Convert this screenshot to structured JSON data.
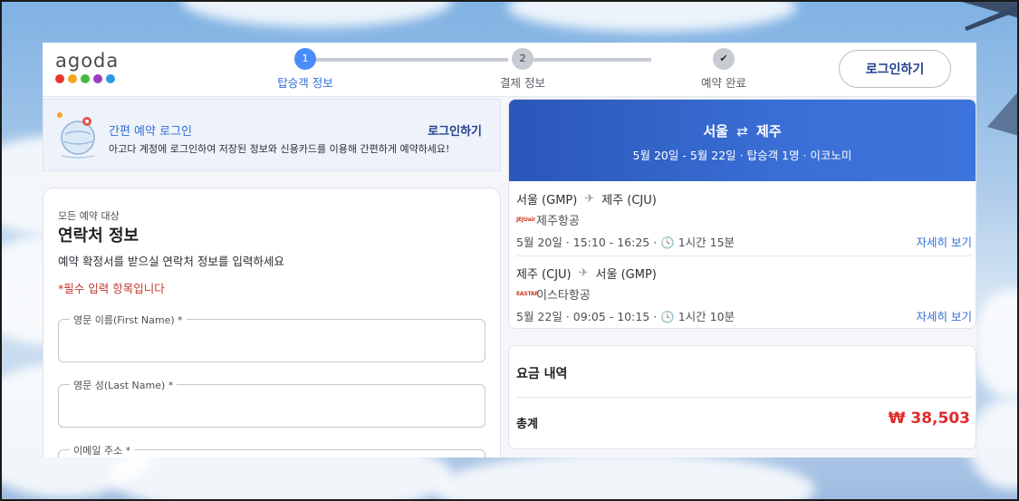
{
  "logo": {
    "text": "agoda",
    "dot_colors": [
      "#e8362f",
      "#f5a623",
      "#46b83f",
      "#9b3cc4",
      "#2c9ae0"
    ]
  },
  "stepper": {
    "steps": [
      {
        "number": "1",
        "label": "탑승객 정보",
        "state": "active"
      },
      {
        "number": "2",
        "label": "결제 정보",
        "state": "pending"
      },
      {
        "number": "✔",
        "label": "예약 완료",
        "state": "done"
      }
    ]
  },
  "header": {
    "login_label": "로그인하기"
  },
  "banner": {
    "title": "간편 예약 로그인",
    "description": "아고다 계정에 로그인하여 저장된 정보와 신용카드를 이용해 간편하게 예약하세요!",
    "link": "로그인하기"
  },
  "contact": {
    "kicker": "모든 예약 대상",
    "title": "연락처 정보",
    "description": "예약 확정서를 받으실 연락처 정보를 입력하세요",
    "required_note": "*필수 입력 항목입니다",
    "fields": [
      {
        "label": "영문 이름(First Name) *",
        "value": ""
      },
      {
        "label": "영문 성(Last Name) *",
        "value": ""
      },
      {
        "label": "이메일 주소 *",
        "value": ""
      }
    ]
  },
  "summary": {
    "route_from": "서울",
    "route_arrow": "⇄",
    "route_to": "제주",
    "subtitle": "5월 20일 - 5월 22일 · 탑승객 1명 · 이코노미",
    "legs": [
      {
        "from": "서울 (GMP)",
        "to": "제주 (CJU)",
        "airline_logo_text": "JEJUair",
        "airline": "제주항공",
        "time": "5월 20일 · 15:10 - 16:25 · 🕓 1시간 15분",
        "detail": "자세히 보기"
      },
      {
        "from": "제주 (CJU)",
        "to": "서울 (GMP)",
        "airline_logo_text": "EASTAR",
        "airline": "이스타항공",
        "time": "5월 22일 · 09:05 - 10:15 · 🕓 1시간 10분",
        "detail": "자세히 보기"
      }
    ]
  },
  "price": {
    "title": "요금 내역",
    "total_label": "총계",
    "total_value": "₩ 38,503"
  },
  "colors": {
    "accent_blue": "#2f6fd6",
    "header_gradient_start": "#2a57b8",
    "price_red": "#e02b2b",
    "required_red": "#c0392b"
  }
}
